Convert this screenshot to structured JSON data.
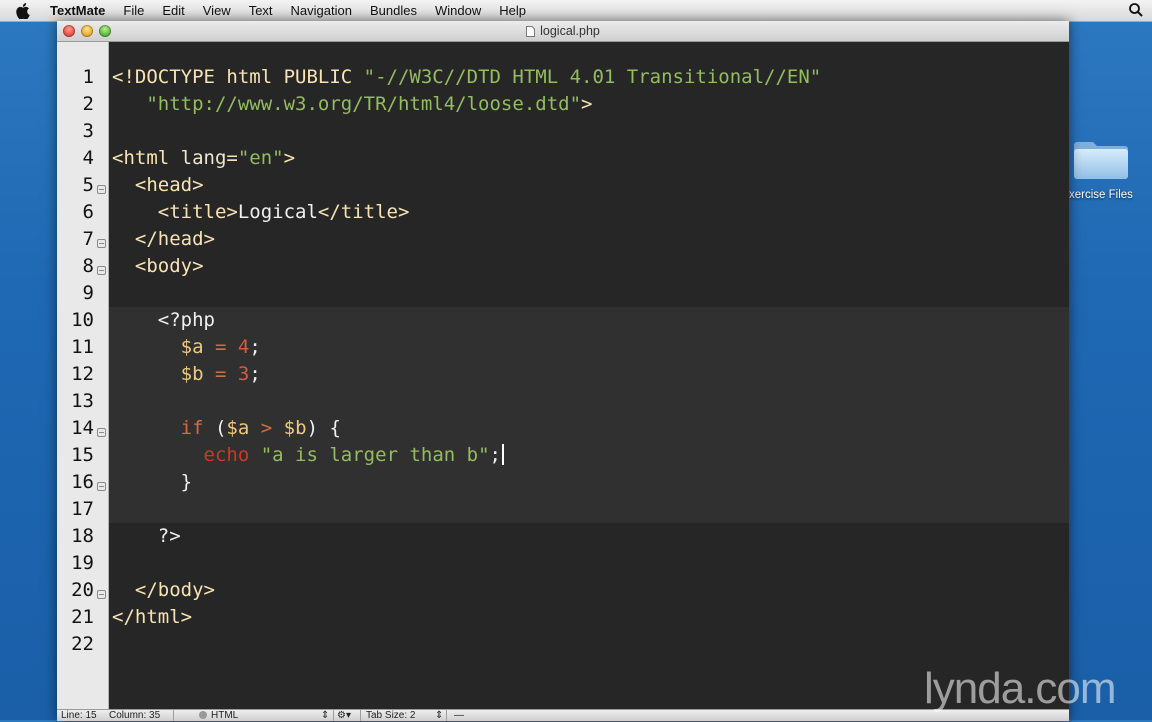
{
  "menubar": {
    "app": "TextMate",
    "items": [
      "File",
      "Edit",
      "View",
      "Text",
      "Navigation",
      "Bundles",
      "Window",
      "Help"
    ],
    "icons": {
      "apple": "apple-icon",
      "search": "spotlight-search-icon"
    }
  },
  "window": {
    "title": "logical.php"
  },
  "desktop": {
    "folder_label": "xercise Files"
  },
  "editor": {
    "lines": [
      {
        "num": "1",
        "fold": false,
        "tokens": [
          [
            "tag",
            "<!DOCTYPE html PUBLIC "
          ],
          [
            "str",
            "\"-//W3C//DTD HTML 4.01 Transitional//EN\""
          ]
        ]
      },
      {
        "num": "2",
        "fold": false,
        "tokens": [
          [
            "plain",
            "   "
          ],
          [
            "str",
            "\"http://www.w3.org/TR/html4/loose.dtd\""
          ],
          [
            "tag",
            ">"
          ]
        ]
      },
      {
        "num": "3",
        "fold": false,
        "tokens": []
      },
      {
        "num": "4",
        "fold": false,
        "tokens": [
          [
            "tag",
            "<html "
          ],
          [
            "attr",
            "lang"
          ],
          [
            "tag",
            "="
          ],
          [
            "str",
            "\"en\""
          ],
          [
            "tag",
            ">"
          ]
        ]
      },
      {
        "num": "5",
        "fold": true,
        "tokens": [
          [
            "plain",
            "  "
          ],
          [
            "tag",
            "<head>"
          ]
        ]
      },
      {
        "num": "6",
        "fold": false,
        "tokens": [
          [
            "plain",
            "    "
          ],
          [
            "tag",
            "<title>"
          ],
          [
            "plain",
            "Logical"
          ],
          [
            "tag",
            "</title>"
          ]
        ]
      },
      {
        "num": "7",
        "fold": true,
        "tokens": [
          [
            "plain",
            "  "
          ],
          [
            "tag",
            "</head>"
          ]
        ]
      },
      {
        "num": "8",
        "fold": true,
        "tokens": [
          [
            "plain",
            "  "
          ],
          [
            "tag",
            "<body>"
          ]
        ]
      },
      {
        "num": "9",
        "fold": false,
        "tokens": []
      },
      {
        "num": "10",
        "fold": false,
        "tokens": [
          [
            "plain",
            "    "
          ],
          [
            "plain",
            "<?php"
          ]
        ]
      },
      {
        "num": "11",
        "fold": false,
        "tokens": [
          [
            "plain",
            "      "
          ],
          [
            "var",
            "$a"
          ],
          [
            "plain",
            " "
          ],
          [
            "kw",
            "="
          ],
          [
            "plain",
            " "
          ],
          [
            "num",
            "4"
          ],
          [
            "plain",
            ";"
          ]
        ]
      },
      {
        "num": "12",
        "fold": false,
        "tokens": [
          [
            "plain",
            "      "
          ],
          [
            "var",
            "$b"
          ],
          [
            "plain",
            " "
          ],
          [
            "kw",
            "="
          ],
          [
            "plain",
            " "
          ],
          [
            "num",
            "3"
          ],
          [
            "plain",
            ";"
          ]
        ]
      },
      {
        "num": "13",
        "fold": false,
        "tokens": []
      },
      {
        "num": "14",
        "fold": true,
        "tokens": [
          [
            "plain",
            "      "
          ],
          [
            "kw",
            "if"
          ],
          [
            "plain",
            " ("
          ],
          [
            "var",
            "$a"
          ],
          [
            "plain",
            " "
          ],
          [
            "kw",
            ">"
          ],
          [
            "plain",
            " "
          ],
          [
            "var",
            "$b"
          ],
          [
            "plain",
            ") {"
          ]
        ]
      },
      {
        "num": "15",
        "fold": false,
        "tokens": [
          [
            "plain",
            "        "
          ],
          [
            "echo",
            "echo"
          ],
          [
            "plain",
            " "
          ],
          [
            "str",
            "\"a is larger than b\""
          ],
          [
            "plain",
            ";"
          ]
        ],
        "cursor": true
      },
      {
        "num": "16",
        "fold": true,
        "tokens": [
          [
            "plain",
            "      "
          ],
          [
            "plain",
            "}"
          ]
        ]
      },
      {
        "num": "17",
        "fold": false,
        "tokens": []
      },
      {
        "num": "18",
        "fold": false,
        "tokens": [
          [
            "plain",
            "    "
          ],
          [
            "plain",
            "?>"
          ]
        ]
      },
      {
        "num": "19",
        "fold": false,
        "tokens": []
      },
      {
        "num": "20",
        "fold": true,
        "tokens": [
          [
            "plain",
            "  "
          ],
          [
            "tag",
            "</body>"
          ]
        ]
      },
      {
        "num": "21",
        "fold": false,
        "tokens": [
          [
            "tag",
            "</html>"
          ]
        ]
      },
      {
        "num": "22",
        "fold": false,
        "tokens": []
      }
    ]
  },
  "statusbar": {
    "line": "Line: 15",
    "column": "Column: 35",
    "language": "HTML",
    "tab_size": "Tab Size:  2"
  },
  "watermark": "lynda.com"
}
